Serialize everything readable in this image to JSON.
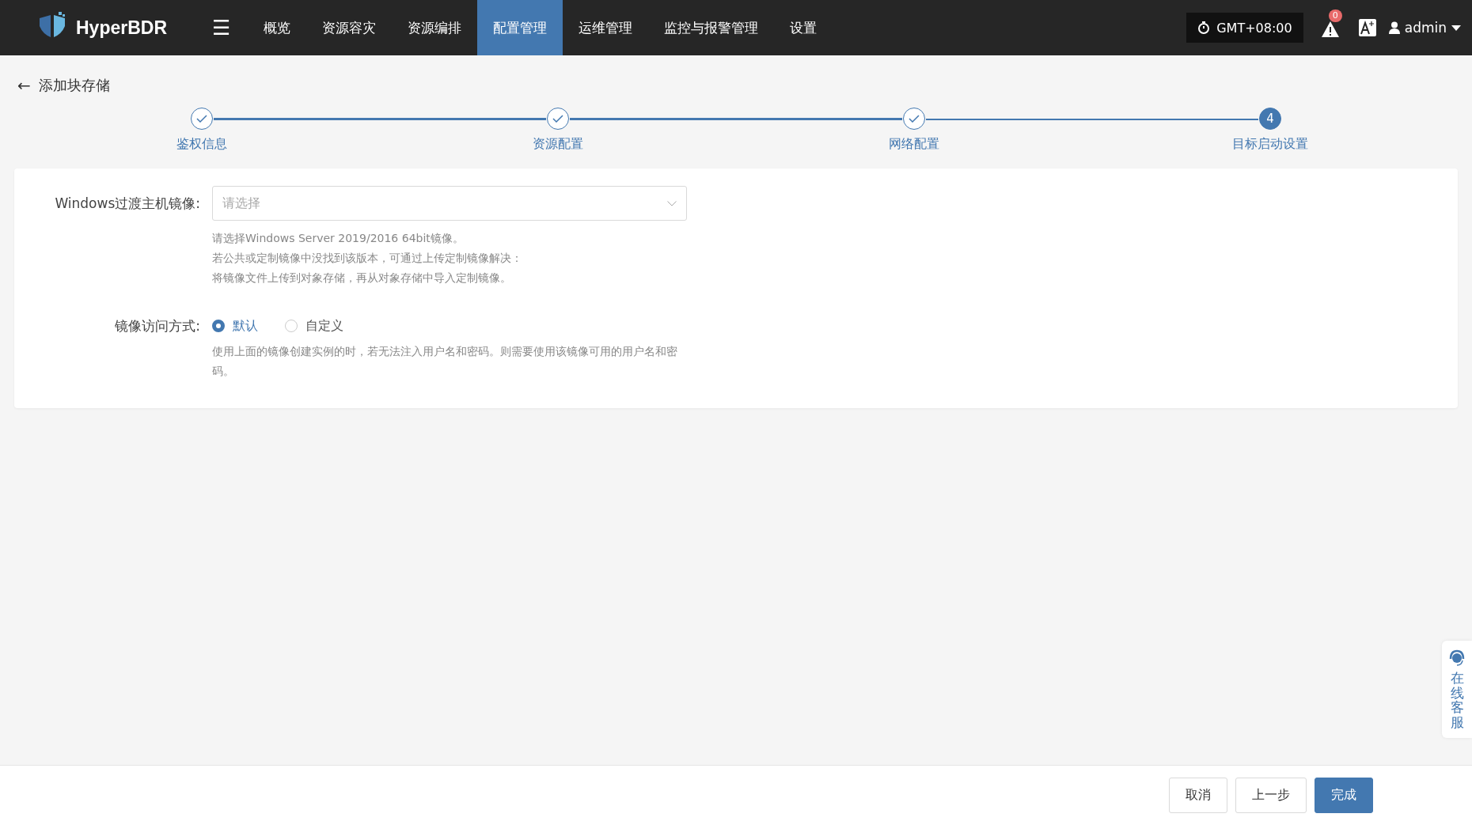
{
  "nav": {
    "brand": "HyperBDR",
    "menu_glyph": "☰",
    "items": [
      {
        "label": "概览",
        "selected": false
      },
      {
        "label": "资源容灾",
        "selected": false
      },
      {
        "label": "资源编排",
        "selected": false
      },
      {
        "label": "配置管理",
        "selected": true
      },
      {
        "label": "运维管理",
        "selected": false
      },
      {
        "label": "监控与报警管理",
        "selected": false
      },
      {
        "label": "设置",
        "selected": false
      }
    ],
    "timezone": "GMT+08:00",
    "alert_count": "0",
    "user": "admin"
  },
  "page": {
    "back_glyph": "←",
    "title": "添加块存储"
  },
  "steps": [
    {
      "label": "鉴权信息",
      "completed": true
    },
    {
      "label": "资源配置",
      "completed": true
    },
    {
      "label": "网络配置",
      "completed": true
    },
    {
      "label": "目标启动设置",
      "completed": false,
      "number": "4"
    }
  ],
  "form": {
    "image": {
      "label": "Windows过渡主机镜像:",
      "placeholder": "请选择",
      "help": [
        "请选择Windows Server 2019/2016 64bit镜像。",
        "若公共或定制镜像中没找到该版本，可通过上传定制镜像解决：",
        "将镜像文件上传到对象存储，再从对象存储中导入定制镜像。"
      ]
    },
    "access": {
      "label": "镜像访问方式:",
      "options": [
        {
          "label": "默认",
          "selected": true
        },
        {
          "label": "自定义",
          "selected": false
        }
      ],
      "help": "使用上面的镜像创建实例的时，若无法注入用户名和密码。则需要使用该镜像可用的用户名和密码。"
    }
  },
  "support": {
    "label": "在线客服"
  },
  "footer": {
    "buttons": [
      {
        "label": "取消",
        "kind": "default"
      },
      {
        "label": "上一步",
        "kind": "default"
      },
      {
        "label": "完成",
        "kind": "primary"
      }
    ]
  }
}
